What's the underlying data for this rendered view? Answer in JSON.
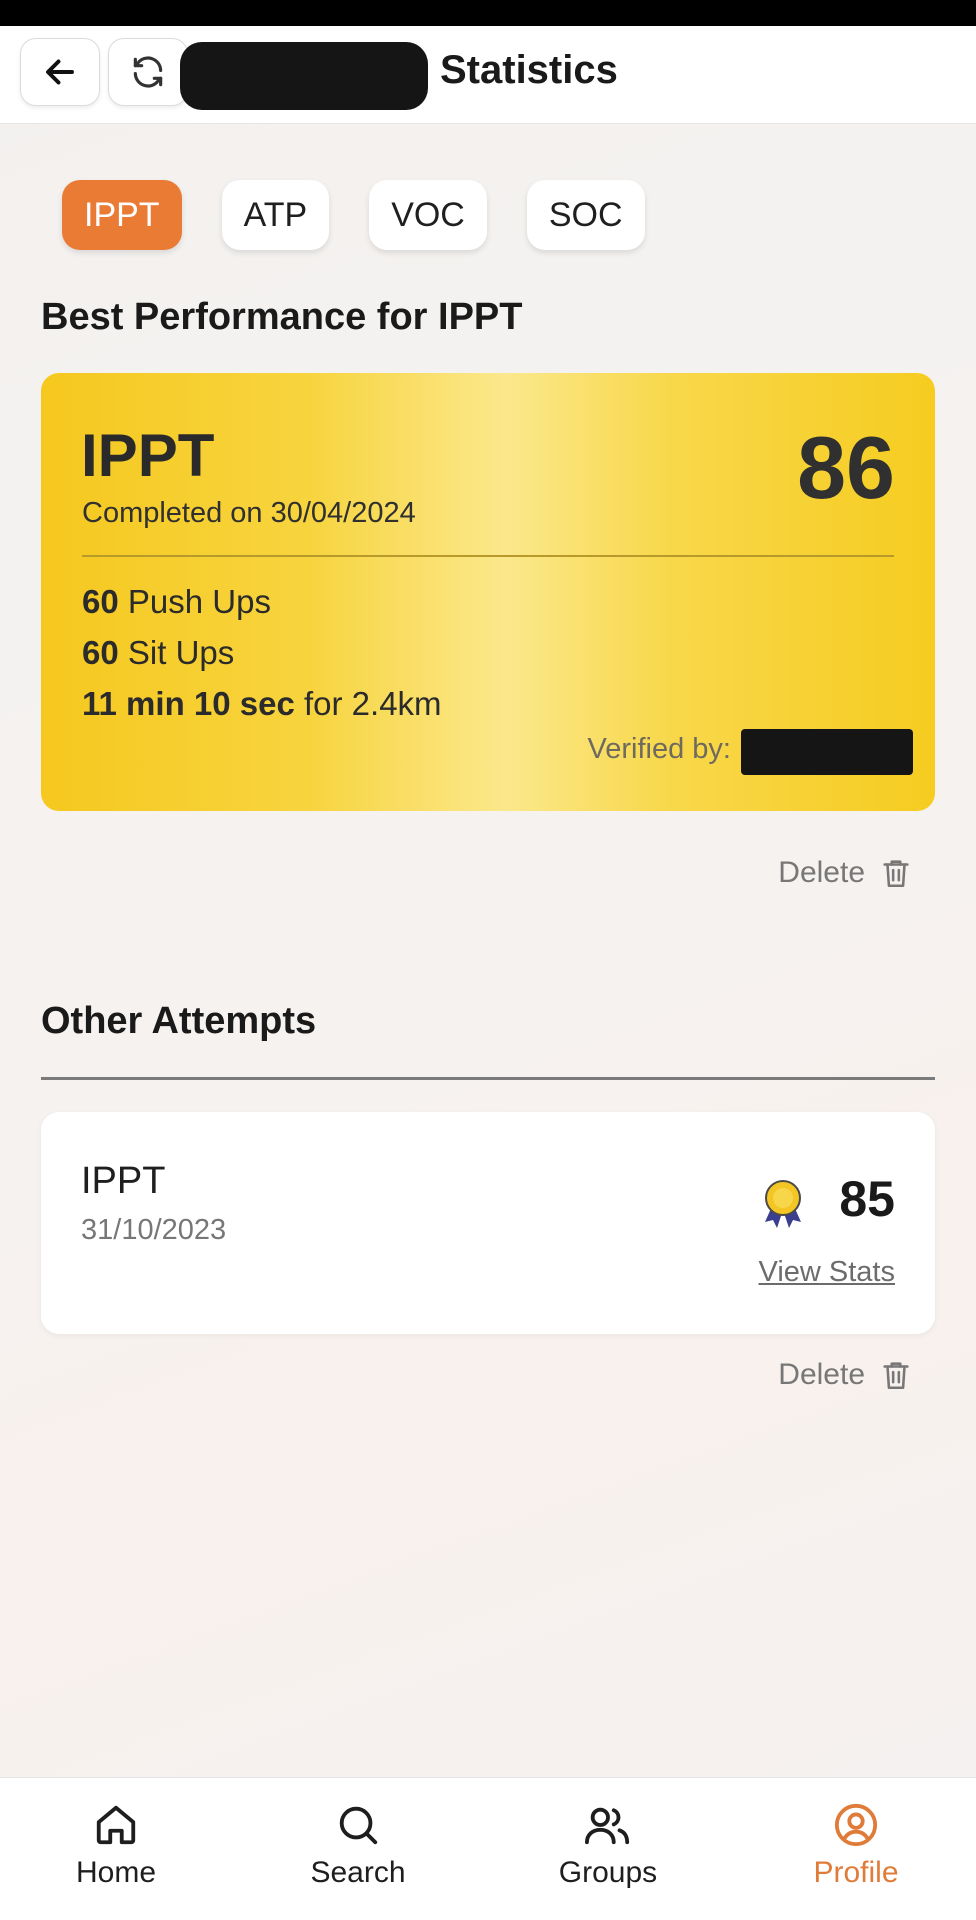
{
  "header": {
    "title": "Statistics"
  },
  "tabs": [
    {
      "label": "IPPT",
      "active": true
    },
    {
      "label": "ATP",
      "active": false
    },
    {
      "label": "VOC",
      "active": false
    },
    {
      "label": "SOC",
      "active": false
    }
  ],
  "best": {
    "heading": "Best Performance for IPPT",
    "name": "IPPT",
    "completed": "Completed on 30/04/2024",
    "score": "86",
    "pushups_value": "60",
    "pushups_label": "Push Ups",
    "situps_value": "60",
    "situps_label": "Sit Ups",
    "run_value": "11 min 10 sec",
    "run_label": "for 2.4km",
    "verified_label": "Verified by:",
    "delete_label": "Delete"
  },
  "other": {
    "heading": "Other Attempts",
    "attempts": [
      {
        "name": "IPPT",
        "date": "31/10/2023",
        "score": "85",
        "link": "View Stats",
        "delete_label": "Delete"
      }
    ]
  },
  "nav": {
    "items": [
      {
        "label": "Home",
        "icon": "home-icon"
      },
      {
        "label": "Search",
        "icon": "search-icon"
      },
      {
        "label": "Groups",
        "icon": "groups-icon"
      },
      {
        "label": "Profile",
        "icon": "profile-icon",
        "active": true
      }
    ]
  },
  "colors": {
    "accent": "#ea7b35",
    "card_gold": "#f6c81f",
    "nav_active": "#e07c39"
  }
}
